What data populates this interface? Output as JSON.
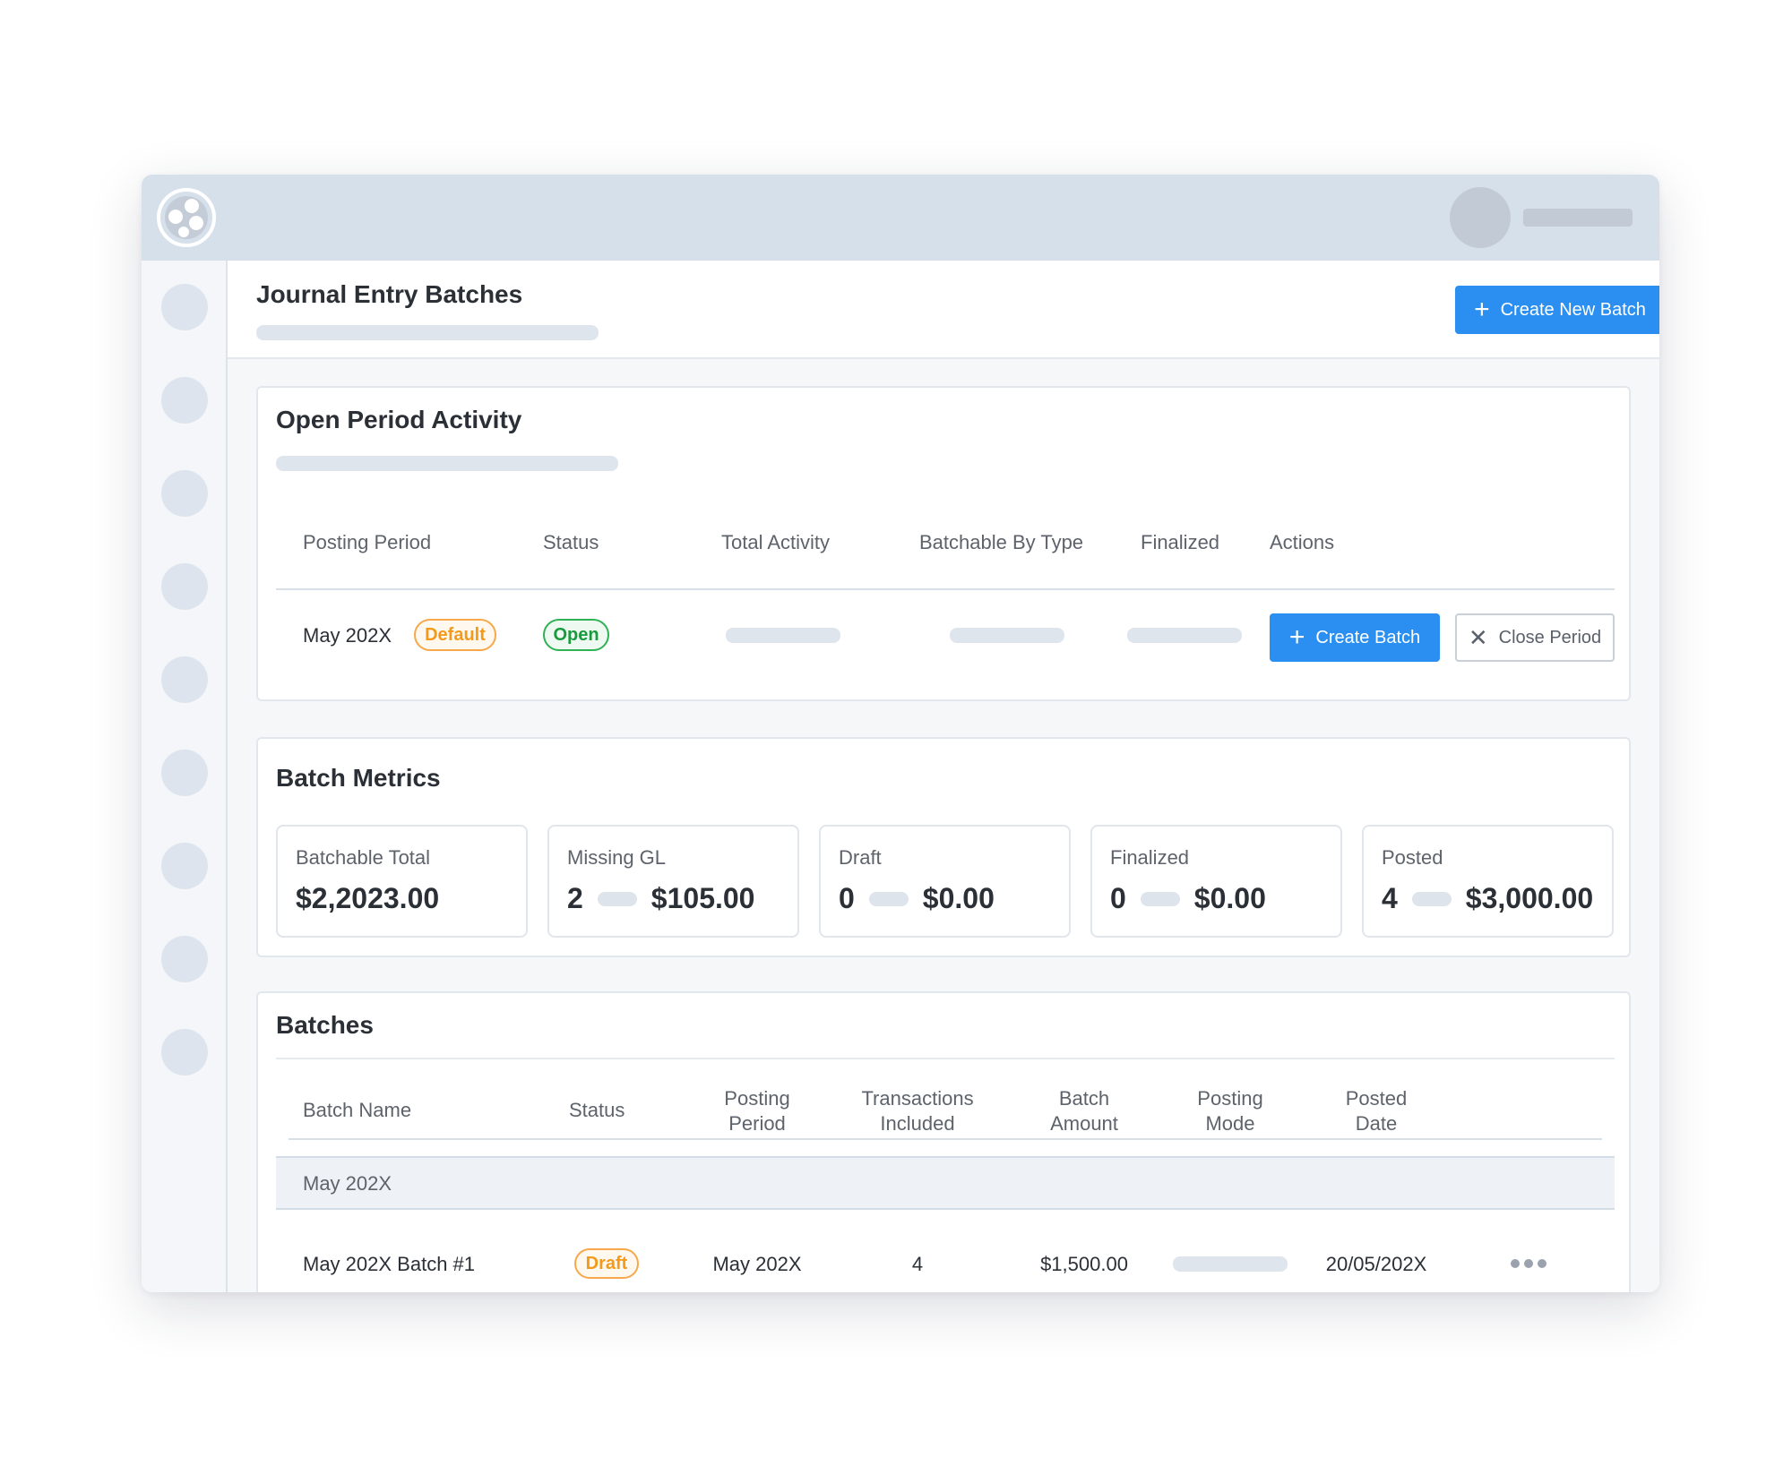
{
  "header": {
    "title": "Journal Entry Batches",
    "create_new_batch_label": "Create New Batch"
  },
  "open_period": {
    "title": "Open Period Activity",
    "columns": [
      "Posting Period",
      "Status",
      "Total Activity",
      "Batchable By Type",
      "Finalized",
      "Actions"
    ],
    "row": {
      "period": "May 202X",
      "period_badge": "Default",
      "status": "Open",
      "create_batch_label": "Create Batch",
      "close_period_label": "Close Period"
    }
  },
  "metrics": {
    "title": "Batch Metrics",
    "cards": [
      {
        "label": "Batchable Total",
        "count": "",
        "amount": "$2,2023.00"
      },
      {
        "label": "Missing GL",
        "count": "2",
        "amount": "$105.00"
      },
      {
        "label": "Draft",
        "count": "0",
        "amount": "$0.00"
      },
      {
        "label": "Finalized",
        "count": "0",
        "amount": "$0.00"
      },
      {
        "label": "Posted",
        "count": "4",
        "amount": "$3,000.00"
      }
    ]
  },
  "batches": {
    "title": "Batches",
    "columns": {
      "batch_name": "Batch Name",
      "status": "Status",
      "posting_period": [
        "Posting",
        "Period"
      ],
      "transactions": [
        "Transactions",
        "Included"
      ],
      "batch_amount": [
        "Batch",
        "Amount"
      ],
      "posting_mode": [
        "Posting",
        "Mode"
      ],
      "posted_date": [
        "Posted",
        "Date"
      ]
    },
    "group": "May 202X",
    "rows": [
      {
        "name": "May 202X Batch #1",
        "status": "Draft",
        "posting_period": "May 202X",
        "transactions": "4",
        "amount": "$1,500.00",
        "posted_date": "20/05/202X"
      }
    ]
  },
  "colors": {
    "primary": "#2a8ff0",
    "topbar": "#d6e0ea",
    "badge_orange": "#f49a1a",
    "badge_green": "#199a3c"
  },
  "icons": [
    "app-logo-icon",
    "plus-icon",
    "close-icon",
    "more-dots-icon"
  ]
}
